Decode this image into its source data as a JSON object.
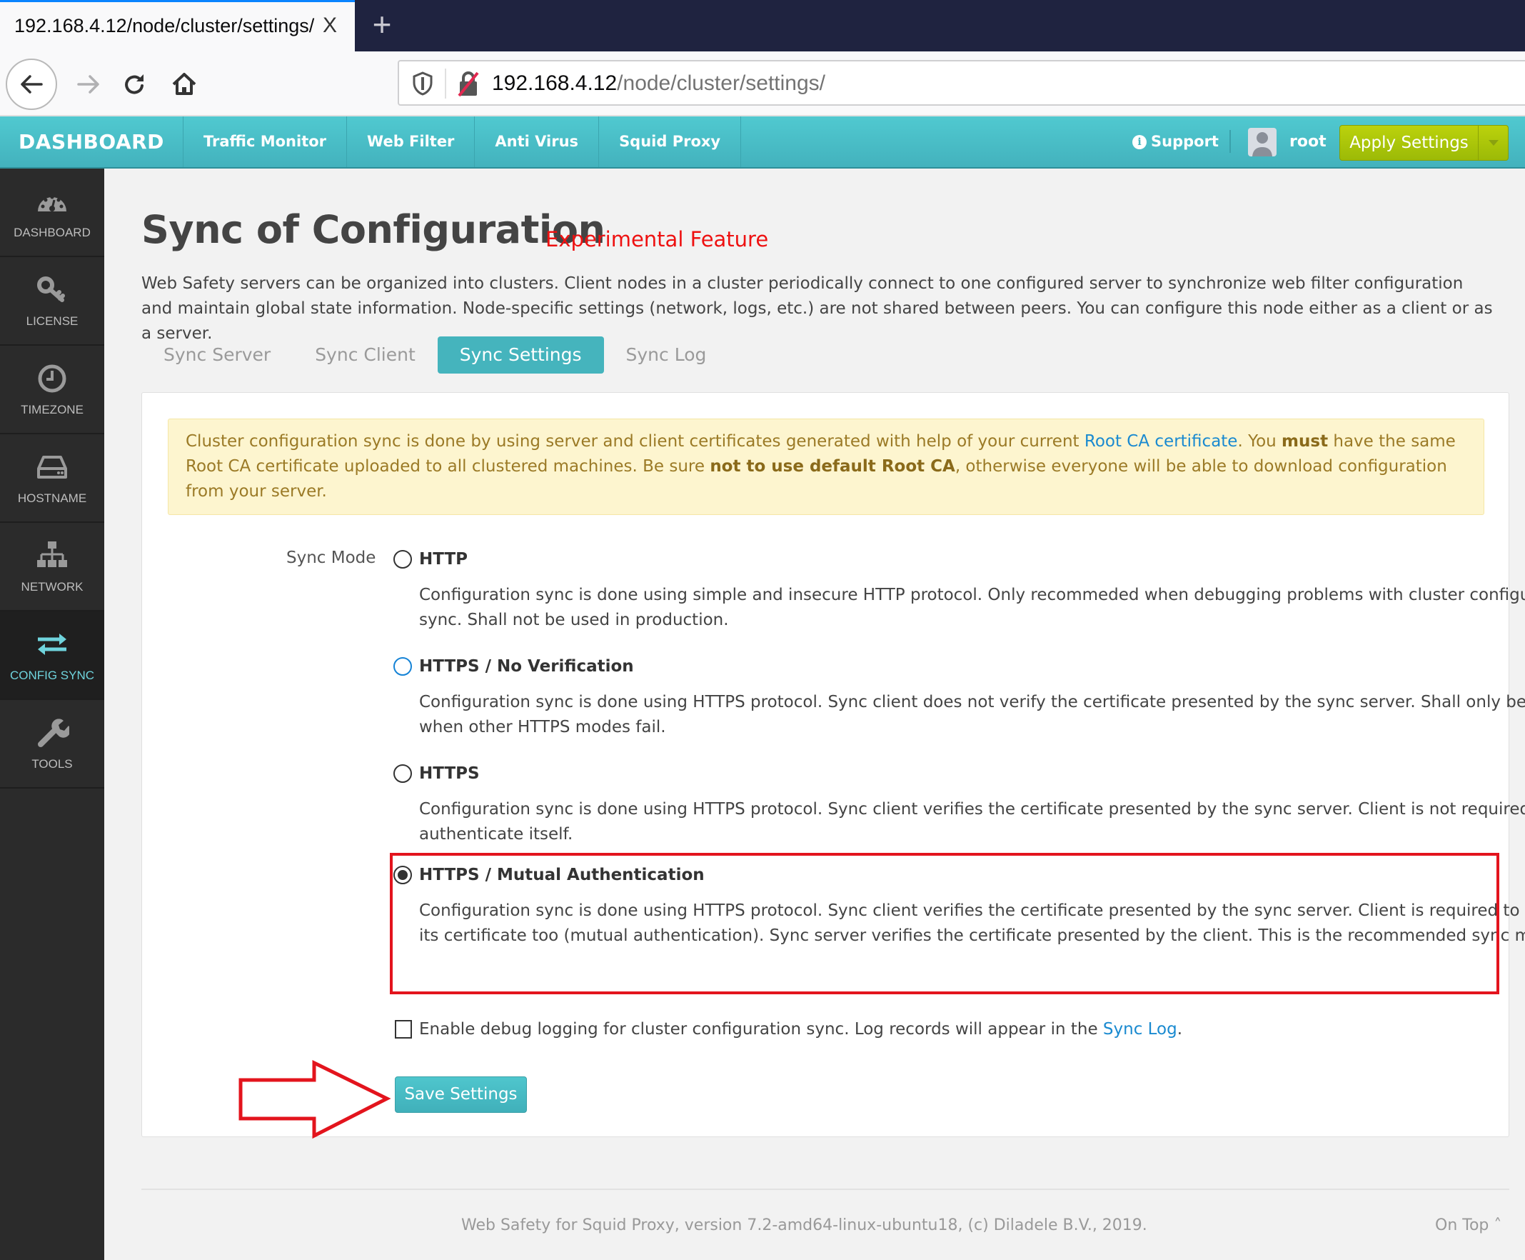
{
  "browser": {
    "tab_title": "192.168.4.12/node/cluster/settings/",
    "tab_close": "X",
    "new_tab": "+",
    "url_host": "192.168.4.12",
    "url_path": "/node/cluster/settings/"
  },
  "appnav": {
    "brand": "DASHBOARD",
    "menu": [
      "Traffic Monitor",
      "Web Filter",
      "Anti Virus",
      "Squid Proxy"
    ],
    "support": "Support",
    "user": "root",
    "apply": "Apply Settings"
  },
  "sidebar": {
    "items": [
      {
        "label": "DASHBOARD",
        "icon": "dashboard-gauge-icon"
      },
      {
        "label": "LICENSE",
        "icon": "key-icon"
      },
      {
        "label": "TIMEZONE",
        "icon": "clock-icon"
      },
      {
        "label": "HOSTNAME",
        "icon": "hard-drive-icon"
      },
      {
        "label": "NETWORK",
        "icon": "network-icon"
      },
      {
        "label": "CONFIG SYNC",
        "icon": "sync-arrows-icon",
        "active": true
      },
      {
        "label": "TOOLS",
        "icon": "wrench-icon"
      }
    ]
  },
  "page": {
    "title": "Sync of Configuration",
    "tag": "Experimental Feature",
    "intro": "Web Safety servers can be organized into clusters. Client nodes in a cluster periodically connect to one configured server to synchronize web filter configuration and maintain global state information. Node-specific settings (network, logs, etc.) are not shared between peers. You can configure this node either as a client or as a server.",
    "tabs": [
      "Sync Server",
      "Sync Client",
      "Sync Settings",
      "Sync Log"
    ],
    "active_tab": "Sync Settings"
  },
  "alert": {
    "t1": "Cluster configuration sync is done by using server and client certificates generated with help of your current ",
    "link": "Root CA certificate",
    "t2": ". You ",
    "b1": "must",
    "t3": " have the same Root CA certificate uploaded to all clustered machines. Be sure ",
    "b2": "not to use default Root CA",
    "t4": ", otherwise everyone will be able to download configuration from your server."
  },
  "form": {
    "sync_mode_label": "Sync Mode",
    "selected_mode": "HTTPS / Mutual Authentication",
    "options": [
      {
        "title": "HTTP",
        "desc": "Configuration sync is done using simple and insecure HTTP protocol. Only recommeded when debugging problems with cluster configuration sync. Shall not be used in production.",
        "checked": false
      },
      {
        "title": "HTTPS / No Verification",
        "desc": "Configuration sync is done using HTTPS protocol. Sync client does not verify the certificate presented by the sync server. Shall only be used when other HTTPS modes fail.",
        "checked": false
      },
      {
        "title": "HTTPS",
        "desc": "Configuration sync is done using HTTPS protocol. Sync client verifies the certificate presented by the sync server. Client is not required to authenticate itself.",
        "checked": false
      },
      {
        "title": "HTTPS / Mutual Authentication",
        "desc": "Configuration sync is done using HTTPS protocol. Sync client verifies the certificate presented by the sync server. Client is required to present its certificate too (mutual authentication). Sync server verifies the certificate presented by the client. This is the recommended sync mode.",
        "checked": true
      }
    ],
    "debug_text": "Enable debug logging for cluster configuration sync. Log records will appear in the ",
    "debug_link": "Sync Log",
    "debug_end": ".",
    "debug_checked": false,
    "save": "Save Settings"
  },
  "footer": {
    "text": "Web Safety for Squid Proxy, version 7.2-amd64-linux-ubuntu18, (c) Diladele B.V., 2019.",
    "on_top": "On Top ˄"
  },
  "colors": {
    "accent": "#45b4bd",
    "apply_green": "#a8c30a",
    "experimental_red": "#ee1111",
    "annotation_red": "#e3141d",
    "link_blue": "#1a8ad0"
  }
}
